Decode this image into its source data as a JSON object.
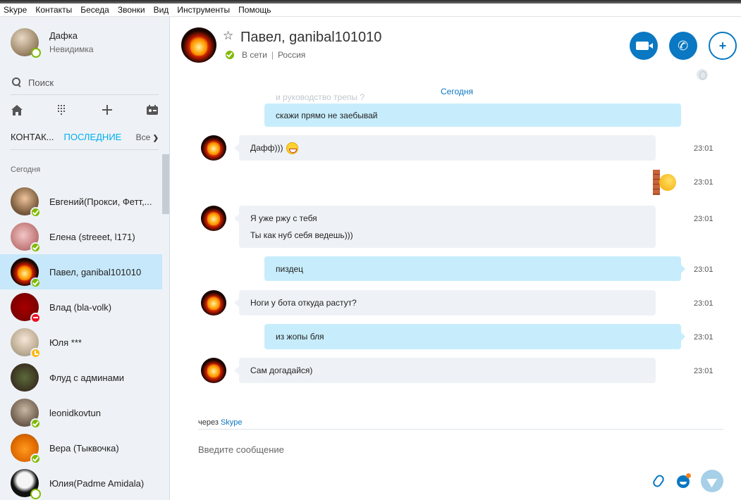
{
  "menu": [
    "Skype",
    "Контакты",
    "Беседа",
    "Звонки",
    "Вид",
    "Инструменты",
    "Помощь"
  ],
  "profile": {
    "name": "Дафка",
    "status": "Невидимка"
  },
  "search": {
    "label": "Поиск"
  },
  "toolbar": {
    "icons": [
      "home-icon",
      "dialpad-icon",
      "plus-icon",
      "contacts-card-icon"
    ]
  },
  "tabs": {
    "contacts": "КОНТАК...",
    "recent": "ПОСЛЕДНИЕ",
    "filter": "Все"
  },
  "sidebar": {
    "section_title": "Сегодня",
    "contacts": [
      {
        "name": "Евгений(Прокси, Фетт,...",
        "status": "online"
      },
      {
        "name": "Елена (streeet, l171)",
        "status": "online"
      },
      {
        "name": "Павел, ganibal101010",
        "status": "online",
        "selected": true
      },
      {
        "name": "Влад (bla-volk)",
        "status": "busy"
      },
      {
        "name": "Юля ***",
        "status": "away"
      },
      {
        "name": "Флуд с админами",
        "status": "none"
      },
      {
        "name": "leonidkovtun",
        "status": "online"
      },
      {
        "name": "Вера (Тыквочка)",
        "status": "online"
      },
      {
        "name": "Юлия(Padme Amidala)",
        "status": "offline"
      }
    ]
  },
  "chat": {
    "name": "Павел, ganibal101010",
    "status_text": "В сети",
    "location": "Россия",
    "day_label": "Сегодня",
    "faded_text": "и руководство трепы ?",
    "messages": [
      {
        "dir": "out",
        "lines": [
          "скажи прямо не заебывай"
        ],
        "time": ""
      },
      {
        "dir": "in",
        "lines": [
          "Дафф)))"
        ],
        "time": "23:01",
        "emoji": "laughing-emoji-icon"
      },
      {
        "dir": "out",
        "lines": [],
        "time": "23:01",
        "emoji": "head-bang-wall-emoji-icon"
      },
      {
        "dir": "in",
        "lines": [
          "Я уже ржу с тебя",
          "Ты как нуб себя ведешь)))"
        ],
        "time": "23:01"
      },
      {
        "dir": "out",
        "lines": [
          "пиздец"
        ],
        "time": "23:01"
      },
      {
        "dir": "in",
        "lines": [
          "Ноги у бота откуда растут?"
        ],
        "time": "23:01"
      },
      {
        "dir": "out",
        "lines": [
          "из жопы бля"
        ],
        "time": "23:01"
      },
      {
        "dir": "in",
        "lines": [
          "Сам догадайся)"
        ],
        "time": "23:01"
      }
    ]
  },
  "compose": {
    "via_prefix": "через",
    "via_link": "Skype",
    "placeholder": "Введите сообщение"
  },
  "colors": {
    "accent": "#0a78c2",
    "online": "#7fba00",
    "busy": "#e81123",
    "away": "#fdb813",
    "selected": "#c7e8fa",
    "out_bubble": "#c7edfc",
    "in_bubble": "#eef2f6"
  }
}
